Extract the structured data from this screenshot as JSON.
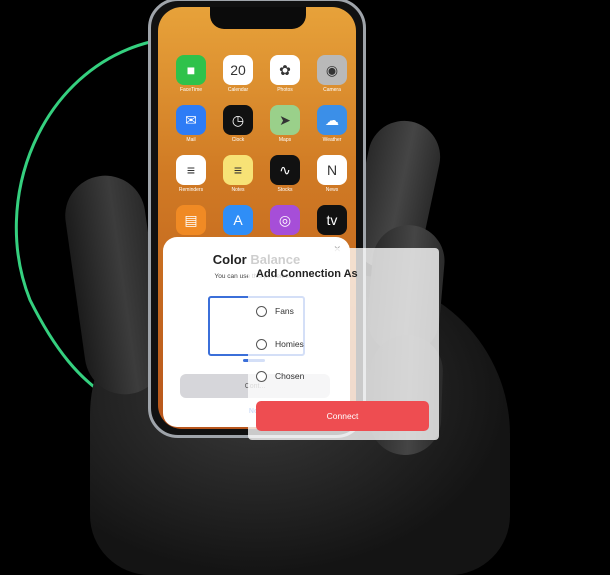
{
  "apps": [
    {
      "name": "FaceTime",
      "color": "#2fc24b",
      "glyph": "■"
    },
    {
      "name": "Calendar",
      "color": "#ffffff",
      "glyph": "20"
    },
    {
      "name": "Photos",
      "color": "#ffffff",
      "glyph": "✿"
    },
    {
      "name": "Camera",
      "color": "#b9b9b9",
      "glyph": "◉"
    },
    {
      "name": "Mail",
      "color": "#2d7cf6",
      "glyph": "✉"
    },
    {
      "name": "Clock",
      "color": "#111111",
      "glyph": "◷"
    },
    {
      "name": "Maps",
      "color": "#9ad08a",
      "glyph": "➤"
    },
    {
      "name": "Weather",
      "color": "#3b8fe8",
      "glyph": "☁"
    },
    {
      "name": "Reminders",
      "color": "#ffffff",
      "glyph": "≡"
    },
    {
      "name": "Notes",
      "color": "#f7e276",
      "glyph": "≡"
    },
    {
      "name": "Stocks",
      "color": "#111111",
      "glyph": "∿"
    },
    {
      "name": "News",
      "color": "#ffffff",
      "glyph": "N"
    },
    {
      "name": "Books",
      "color": "#f08a24",
      "glyph": "▤"
    },
    {
      "name": "App Store",
      "color": "#2f8ef7",
      "glyph": "A"
    },
    {
      "name": "Podcasts",
      "color": "#a64ed8",
      "glyph": "◎"
    },
    {
      "name": "TV",
      "color": "#111111",
      "glyph": "tv"
    }
  ],
  "color_balance": {
    "title": "Color Balance",
    "text": "You can use this p... televis...",
    "button": "Cont...",
    "link": "No..."
  },
  "add_connection": {
    "title": "Add Connection As",
    "options": [
      "Fans",
      "Homies",
      "Chosen"
    ],
    "button": "Connect"
  },
  "colors": {
    "accent_green": "#35d07f",
    "connect_red": "#ee4d51",
    "dialog_blue": "#3b6fd9"
  }
}
